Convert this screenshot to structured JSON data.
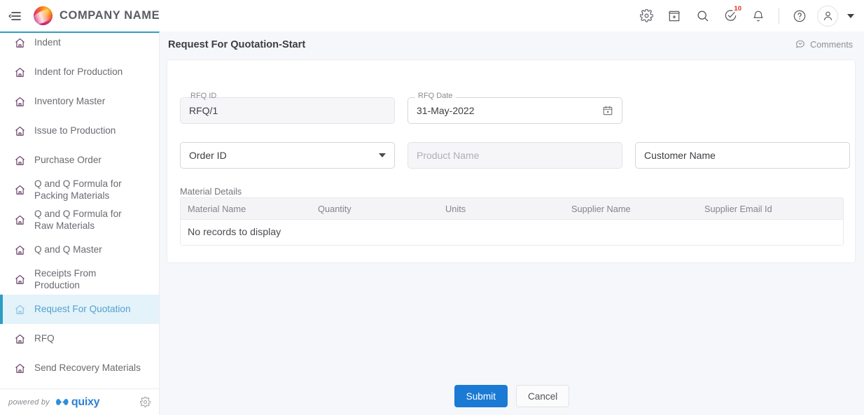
{
  "topbar": {
    "menu_icon": "hamburger-collapse-icon",
    "brand_name": "COMPANY NAME",
    "icons": [
      {
        "name": "settings-icon",
        "label": "Settings"
      },
      {
        "name": "store-icon",
        "label": "App Store"
      },
      {
        "name": "search-icon",
        "label": "Search"
      },
      {
        "name": "tasks-icon",
        "label": "Tasks",
        "badge": "10"
      },
      {
        "name": "bell-icon",
        "label": "Notifications"
      },
      {
        "name": "help-icon",
        "label": "Help"
      },
      {
        "name": "avatar-icon",
        "label": "Profile"
      }
    ],
    "badge_count": "10",
    "badge_color": "#e0321e"
  },
  "sidebar": {
    "items": [
      {
        "label": "Indent",
        "active": false
      },
      {
        "label": "Indent for Production",
        "active": false
      },
      {
        "label": "Inventory Master",
        "active": false
      },
      {
        "label": "Issue to Production",
        "active": false
      },
      {
        "label": "Purchase Order",
        "active": false
      },
      {
        "label": "Q and Q Formula for\nPacking Materials",
        "active": false
      },
      {
        "label": "Q and Q Formula for\nRaw Materials",
        "active": false
      },
      {
        "label": "Q and Q Master",
        "active": false
      },
      {
        "label": "Receipts From\nProduction",
        "active": false
      },
      {
        "label": "Request For Quotation",
        "active": true
      },
      {
        "label": "RFQ",
        "active": false
      },
      {
        "label": "Send Recovery Materials",
        "active": false
      }
    ],
    "footer": {
      "powered_by": "powered by",
      "vendor": "quixy",
      "settings_icon": "gear-icon"
    },
    "active_bg": "#e4f2fa",
    "active_accent": "#2e9ec3",
    "active_text": "#52a3cf"
  },
  "main": {
    "page_title": "Request For Quotation-Start",
    "comments_label": "Comments",
    "fields": {
      "rfq_id": {
        "label": "RFQ ID",
        "value": "RFQ/1",
        "placeholder": "",
        "disabled": true
      },
      "rfq_date": {
        "label": "RFQ Date",
        "value": "31-May-2022",
        "placeholder": "",
        "disabled": false,
        "trailing_icon": "calendar-icon"
      },
      "order_id": {
        "label": "",
        "value": "Order ID",
        "placeholder": "Order ID",
        "disabled": false,
        "trailing_icon": "chevron-down-icon"
      },
      "product_name": {
        "label": "",
        "value": "",
        "placeholder": "Product Name",
        "disabled": true
      },
      "customer_name": {
        "label": "",
        "value": "Customer Name",
        "placeholder": "Customer Name",
        "disabled": false
      }
    },
    "material_details": {
      "title": "Material Details",
      "columns": [
        "Material Name",
        "Quantity",
        "Units",
        "Supplier Name",
        "Supplier Email Id"
      ],
      "rows": [],
      "empty_message": "No records to display"
    },
    "buttons": {
      "submit": "Submit",
      "cancel": "Cancel",
      "submit_color": "#1a7ad4"
    }
  }
}
